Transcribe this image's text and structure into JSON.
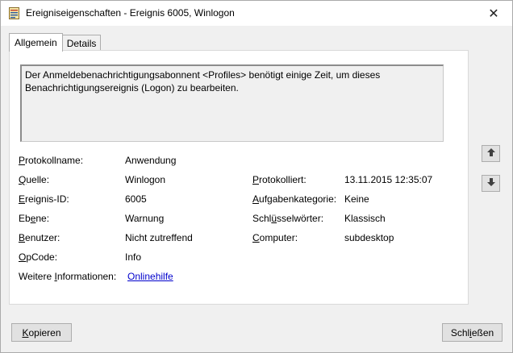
{
  "window": {
    "title": "Ereigniseigenschaften - Ereignis 6005, Winlogon",
    "close_glyph": "✕"
  },
  "tabs": [
    {
      "label": "Allgemein",
      "active": true
    },
    {
      "label": "Details",
      "active": false
    }
  ],
  "description": "Der Anmeldebenachrichtigungsabonnent <Profiles> benötigt einige Zeit, um dieses Benachrichtigungsereignis (Logon) zu bearbeiten.",
  "fields": {
    "log_name": {
      "label_pre": "",
      "label_acc": "P",
      "label_post": "rotokollname:",
      "value": "Anwendung"
    },
    "source": {
      "label_pre": "",
      "label_acc": "Q",
      "label_post": "uelle:",
      "value": "Winlogon"
    },
    "event_id": {
      "label_pre": "",
      "label_acc": "E",
      "label_post": "reignis-ID:",
      "value": "6005"
    },
    "level": {
      "label_pre": "Eb",
      "label_acc": "e",
      "label_post": "ne:",
      "value": "Warnung"
    },
    "user": {
      "label_pre": "",
      "label_acc": "B",
      "label_post": "enutzer:",
      "value": "Nicht zutreffend"
    },
    "opcode": {
      "label_pre": "",
      "label_acc": "O",
      "label_post": "pCode:",
      "value": "Info"
    },
    "more_info": {
      "label_pre": "Weitere ",
      "label_acc": "I",
      "label_post": "nformationen:",
      "value": "Onlinehilfe"
    },
    "logged": {
      "label_pre": "",
      "label_acc": "P",
      "label_post": "rotokolliert:",
      "value": "13.11.2015 12:35:07"
    },
    "task_category": {
      "label_pre": "",
      "label_acc": "A",
      "label_post": "ufgabenkategorie:",
      "value": "Keine"
    },
    "keywords": {
      "label_pre": "Schl",
      "label_acc": "ü",
      "label_post": "sselwörter:",
      "value": "Klassisch"
    },
    "computer": {
      "label_pre": "",
      "label_acc": "C",
      "label_post": "omputer:",
      "value": "subdesktop"
    }
  },
  "buttons": {
    "copy": {
      "pre": "",
      "acc": "K",
      "post": "opieren"
    },
    "close": {
      "pre": "Schl",
      "acc": "i",
      "post": "eßen"
    }
  },
  "icons": {
    "up": "arrow-up-icon",
    "down": "arrow-down-icon",
    "app": "event-viewer-icon"
  }
}
